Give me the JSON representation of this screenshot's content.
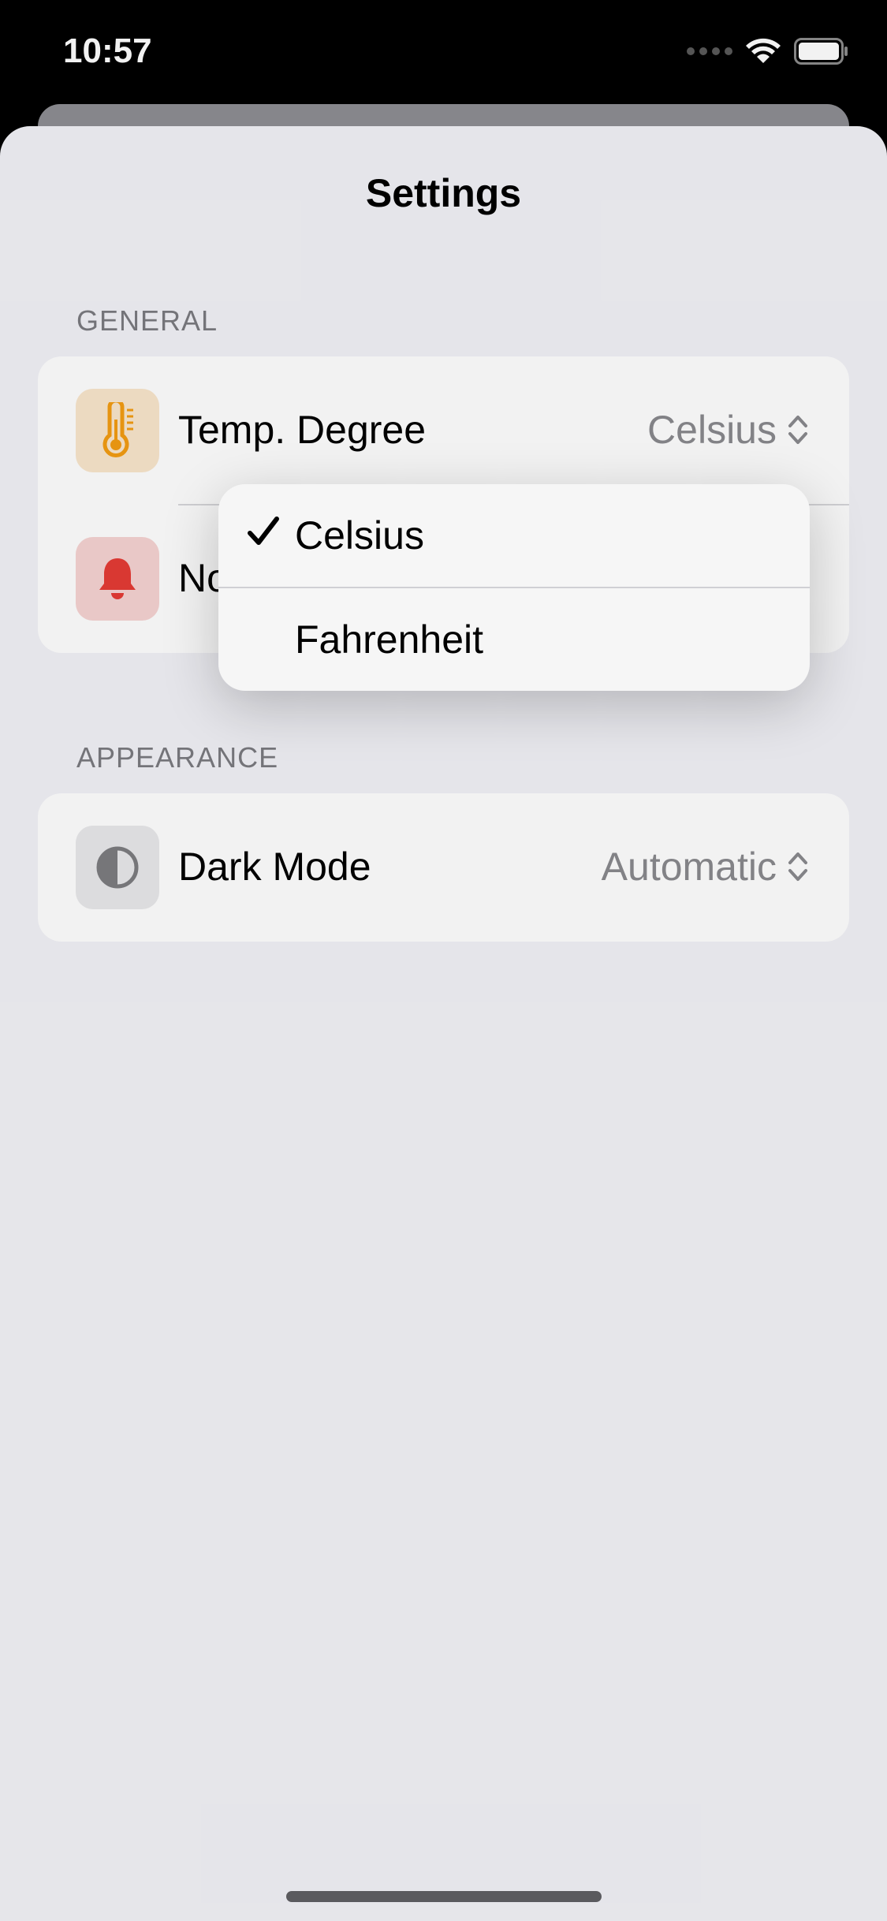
{
  "status_bar": {
    "time": "10:57"
  },
  "sheet": {
    "title": "Settings"
  },
  "sections": {
    "general": {
      "header": "GENERAL",
      "temp_row": {
        "label": "Temp. Degree",
        "value": "Celsius",
        "icon": "thermometer-icon",
        "icon_bg": "#f9e6cc",
        "icon_color": "#f39c12"
      },
      "notification_row": {
        "label_partial": "No",
        "icon": "bell-icon",
        "icon_bg": "#f6d3d2",
        "icon_color": "#e53b35"
      }
    },
    "appearance": {
      "header": "APPEARANCE",
      "dark_mode_row": {
        "label": "Dark Mode",
        "value": "Automatic",
        "icon": "contrast-icon",
        "icon_bg": "#e8e8ea",
        "icon_color": "#7d7d80"
      }
    }
  },
  "temp_menu": {
    "options": [
      {
        "label": "Celsius",
        "selected": true
      },
      {
        "label": "Fahrenheit",
        "selected": false
      }
    ]
  }
}
